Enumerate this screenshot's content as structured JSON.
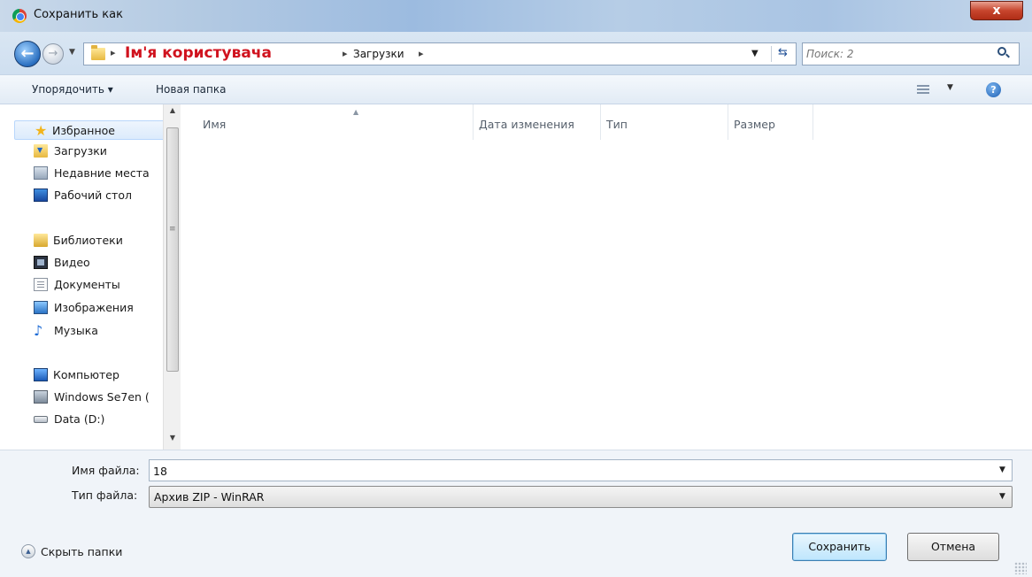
{
  "window": {
    "title": "Сохранить как",
    "close_label": "x"
  },
  "address_bar": {
    "crumbs": [
      "Ім'я користувача",
      "Загрузки"
    ],
    "separator": "▸"
  },
  "search": {
    "placeholder": "Поиск: 2"
  },
  "toolbar": {
    "organize_label": "Упорядочить ▾",
    "new_folder_label": "Новая папка"
  },
  "sidebar": {
    "favorites": {
      "label": "Избранное",
      "items": [
        {
          "label": "Загрузки",
          "icon": "downloads-icon"
        },
        {
          "label": "Недавние места",
          "icon": "recent-places-icon"
        },
        {
          "label": "Рабочий стол",
          "icon": "desktop-icon"
        }
      ]
    },
    "libraries": {
      "label": "Библиотеки",
      "items": [
        {
          "label": "Видео",
          "icon": "video-icon"
        },
        {
          "label": "Документы",
          "icon": "documents-icon"
        },
        {
          "label": "Изображения",
          "icon": "images-icon"
        },
        {
          "label": "Музыка",
          "icon": "music-icon"
        }
      ]
    },
    "computer": {
      "label": "Компьютер",
      "items": [
        {
          "label": "Windows Se7en (",
          "icon": "windows-drive-icon"
        },
        {
          "label": "Data (D:)",
          "icon": "drive-icon"
        }
      ]
    }
  },
  "file_list": {
    "columns": [
      "Имя",
      "Дата изменения",
      "Тип",
      "Размер"
    ]
  },
  "form": {
    "filename_label": "Имя файла:",
    "filename_value": "18",
    "filetype_label": "Тип файла:",
    "filetype_value": "Архив ZIP - WinRAR"
  },
  "footer": {
    "hide_folders_label": "Скрыть папки",
    "save_label": "Сохранить",
    "cancel_label": "Отмена"
  },
  "colors": {
    "username_crumb": "#d0121e",
    "selection": "#dcebfc"
  }
}
